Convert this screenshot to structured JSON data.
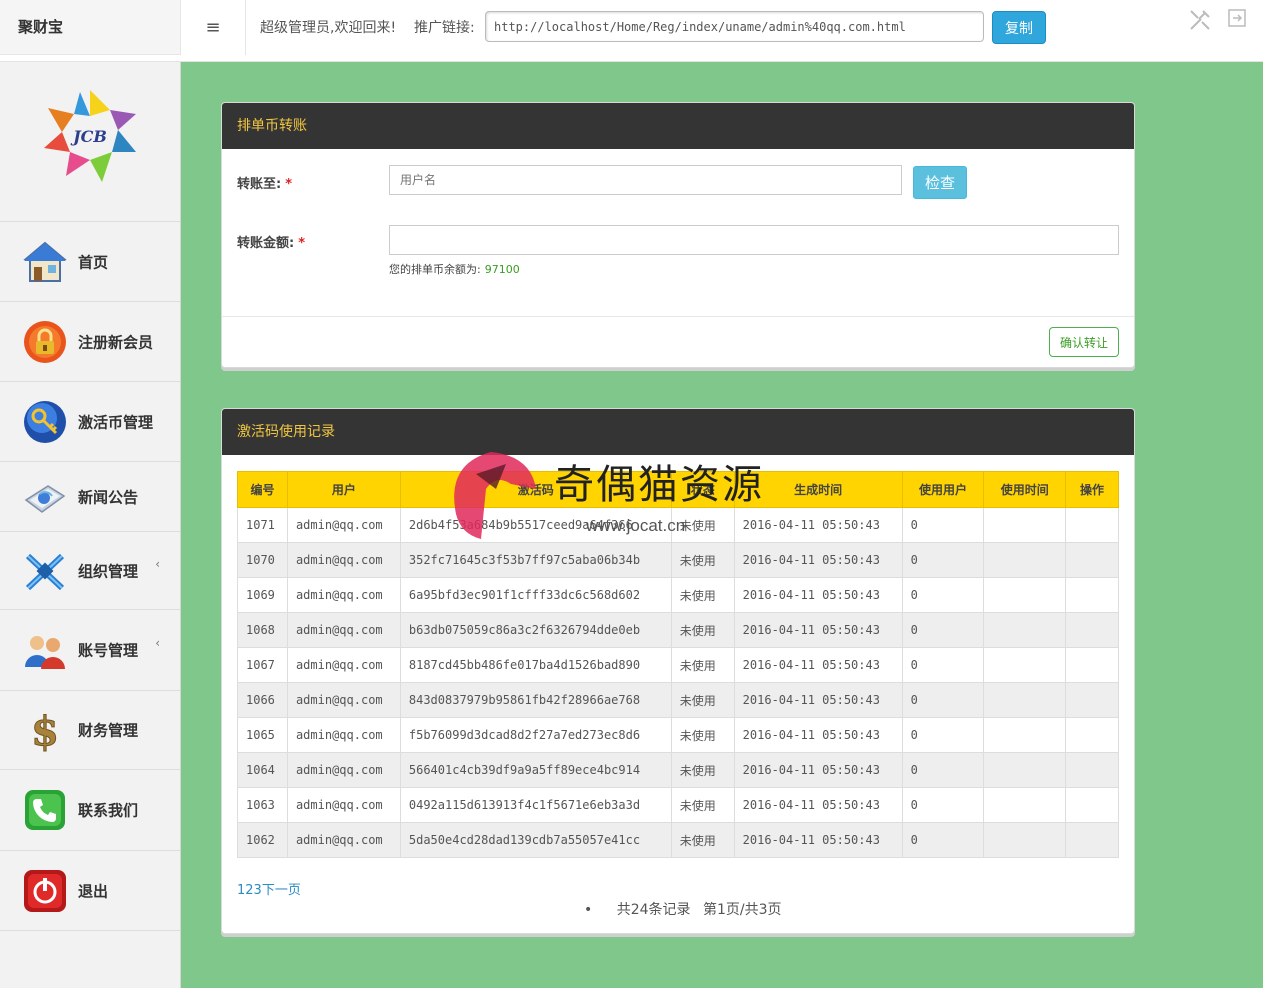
{
  "header": {
    "brand": "聚财宝",
    "menu_toggle": "≡",
    "welcome": "超级管理员,欢迎回来!",
    "promo_label": "推广链接:",
    "promo_url": "http://localhost/Home/Reg/index/uname/admin%40qq.com.html",
    "copy_label": "复制",
    "tools_icon": "tools-icon",
    "logout_icon": "logout-icon"
  },
  "sidebar": {
    "logo_text": "JCB",
    "items": [
      {
        "label": "首页",
        "icon": "home-icon"
      },
      {
        "label": "注册新会员",
        "icon": "lock-icon"
      },
      {
        "label": "激活币管理",
        "icon": "key-icon"
      },
      {
        "label": "新闻公告",
        "icon": "news-icon"
      },
      {
        "label": "组织管理",
        "icon": "network-icon",
        "caret": "‹"
      },
      {
        "label": "账号管理",
        "icon": "users-icon",
        "caret": "‹"
      },
      {
        "label": "财务管理",
        "icon": "dollar-icon"
      },
      {
        "label": "联系我们",
        "icon": "phone-icon"
      },
      {
        "label": "退出",
        "icon": "power-icon"
      }
    ]
  },
  "transfer": {
    "title": "排单币转账",
    "to_label": "转账至:",
    "amount_label": "转账金额:",
    "required_mark": "*",
    "username_placeholder": "用户名",
    "check_label": "检查",
    "balance_prefix": "您的排单币余额为:",
    "balance_value": "97100",
    "confirm_label": "确认转让"
  },
  "records": {
    "title": "激活码使用记录",
    "columns": [
      "编号",
      "用户",
      "激活码",
      "状态",
      "生成时间",
      "使用用户",
      "使用时间",
      "操作"
    ],
    "rows": [
      [
        "1071",
        "admin@qq.com",
        "2d6b4f53a684b9b5517ceed9a64f366",
        "未使用",
        "2016-04-11 05:50:43",
        "0",
        "",
        ""
      ],
      [
        "1070",
        "admin@qq.com",
        "352fc71645c3f53b7ff97c5aba06b34b",
        "未使用",
        "2016-04-11 05:50:43",
        "0",
        "",
        ""
      ],
      [
        "1069",
        "admin@qq.com",
        "6a95bfd3ec901f1cfff33dc6c568d602",
        "未使用",
        "2016-04-11 05:50:43",
        "0",
        "",
        ""
      ],
      [
        "1068",
        "admin@qq.com",
        "b63db075059c86a3c2f6326794dde0eb",
        "未使用",
        "2016-04-11 05:50:43",
        "0",
        "",
        ""
      ],
      [
        "1067",
        "admin@qq.com",
        "8187cd45bb486fe017ba4d1526bad890",
        "未使用",
        "2016-04-11 05:50:43",
        "0",
        "",
        ""
      ],
      [
        "1066",
        "admin@qq.com",
        "843d0837979b95861fb42f28966ae768",
        "未使用",
        "2016-04-11 05:50:43",
        "0",
        "",
        ""
      ],
      [
        "1065",
        "admin@qq.com",
        "f5b76099d3dcad8d2f27a7ed273ec8d6",
        "未使用",
        "2016-04-11 05:50:43",
        "0",
        "",
        ""
      ],
      [
        "1064",
        "admin@qq.com",
        "566401c4cb39df9a9a5ff89ece4bc914",
        "未使用",
        "2016-04-11 05:50:43",
        "0",
        "",
        ""
      ],
      [
        "1063",
        "admin@qq.com",
        "0492a115d613913f4c1f5671e6eb3a3d",
        "未使用",
        "2016-04-11 05:50:43",
        "0",
        "",
        ""
      ],
      [
        "1062",
        "admin@qq.com",
        "5da50e4cd28dad139cdb7a55057e41cc",
        "未使用",
        "2016-04-11 05:50:43",
        "0",
        "",
        ""
      ]
    ],
    "pager_links": "123下一页",
    "pager_bullet": "•",
    "pager_total": "共24条记录",
    "pager_pages": "第1页/共3页"
  },
  "watermark": {
    "title": "奇偶猫资源",
    "url": "www.jocat.cn"
  },
  "colors": {
    "main_bg": "#80c78b",
    "panel_head": "#343434",
    "panel_title": "#f0c640",
    "table_head": "#ffd400",
    "copy_button": "#2fa6dc",
    "check_button": "#5bc0de"
  }
}
